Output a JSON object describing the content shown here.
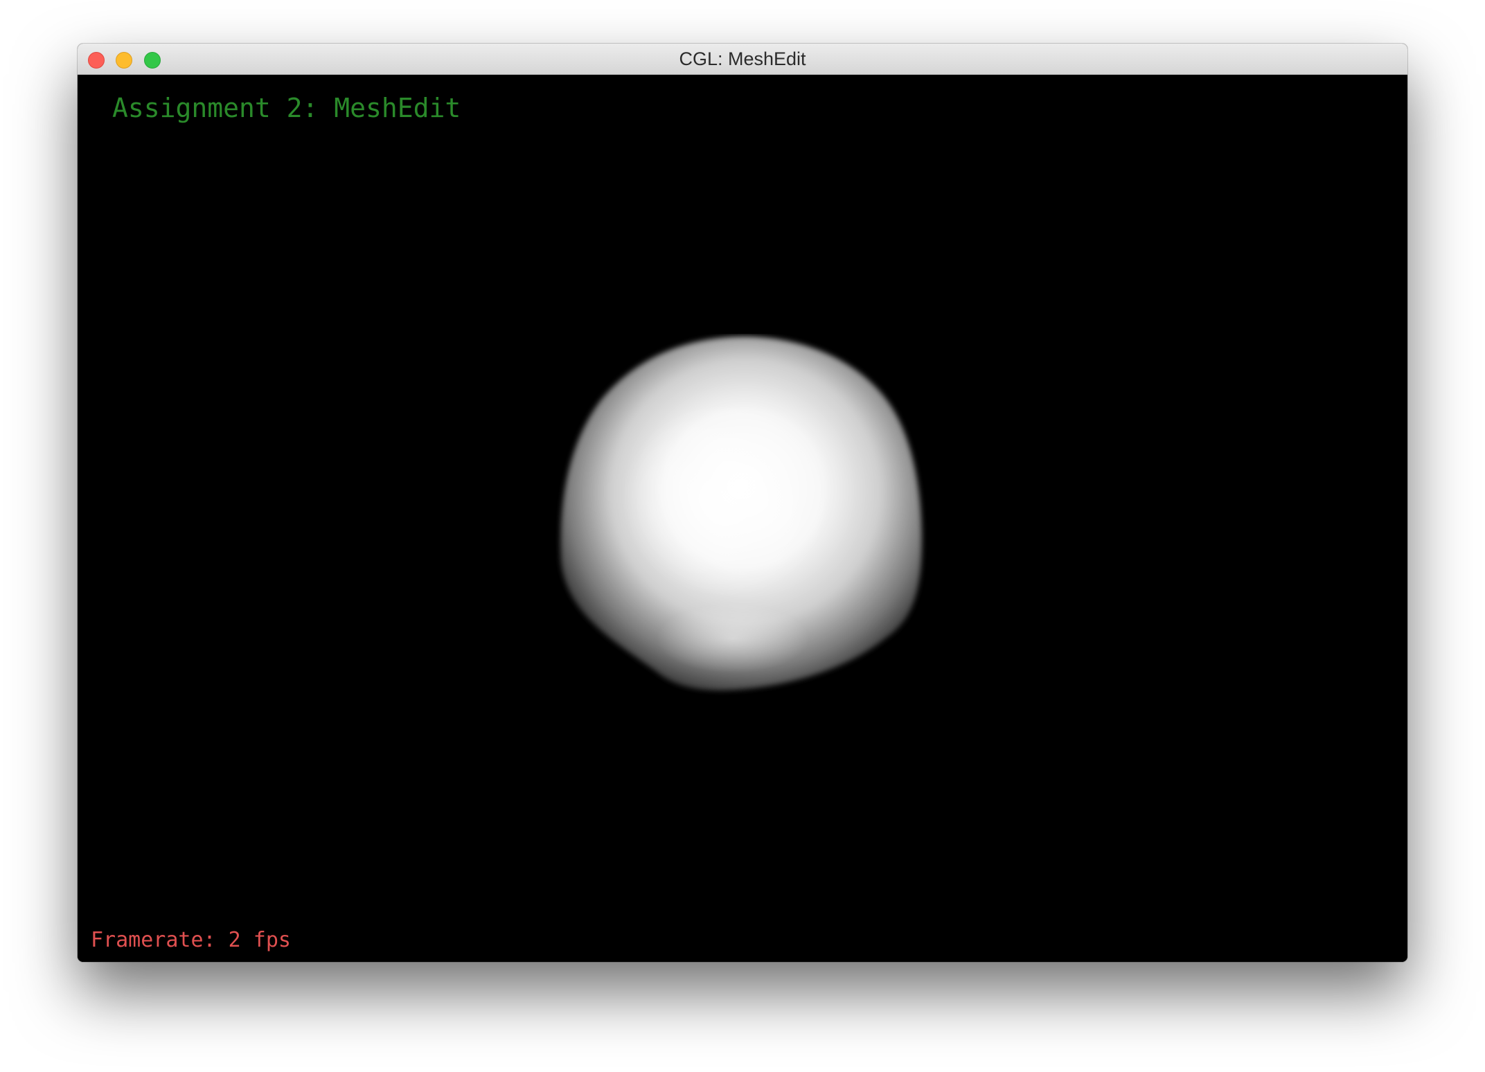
{
  "window": {
    "title": "CGL: MeshEdit"
  },
  "viewport": {
    "heading": "Assignment 2: MeshEdit",
    "framerate_text": "Framerate: 2 fps",
    "heading_color": "#2a8a2a",
    "framerate_color": "#e05050",
    "background": "#000000",
    "mesh_object": "smooth-shaded-subdivided-cube"
  },
  "traffic_lights": {
    "close": "#fc5f57",
    "minimize": "#fdbc2e",
    "zoom": "#33c748"
  }
}
